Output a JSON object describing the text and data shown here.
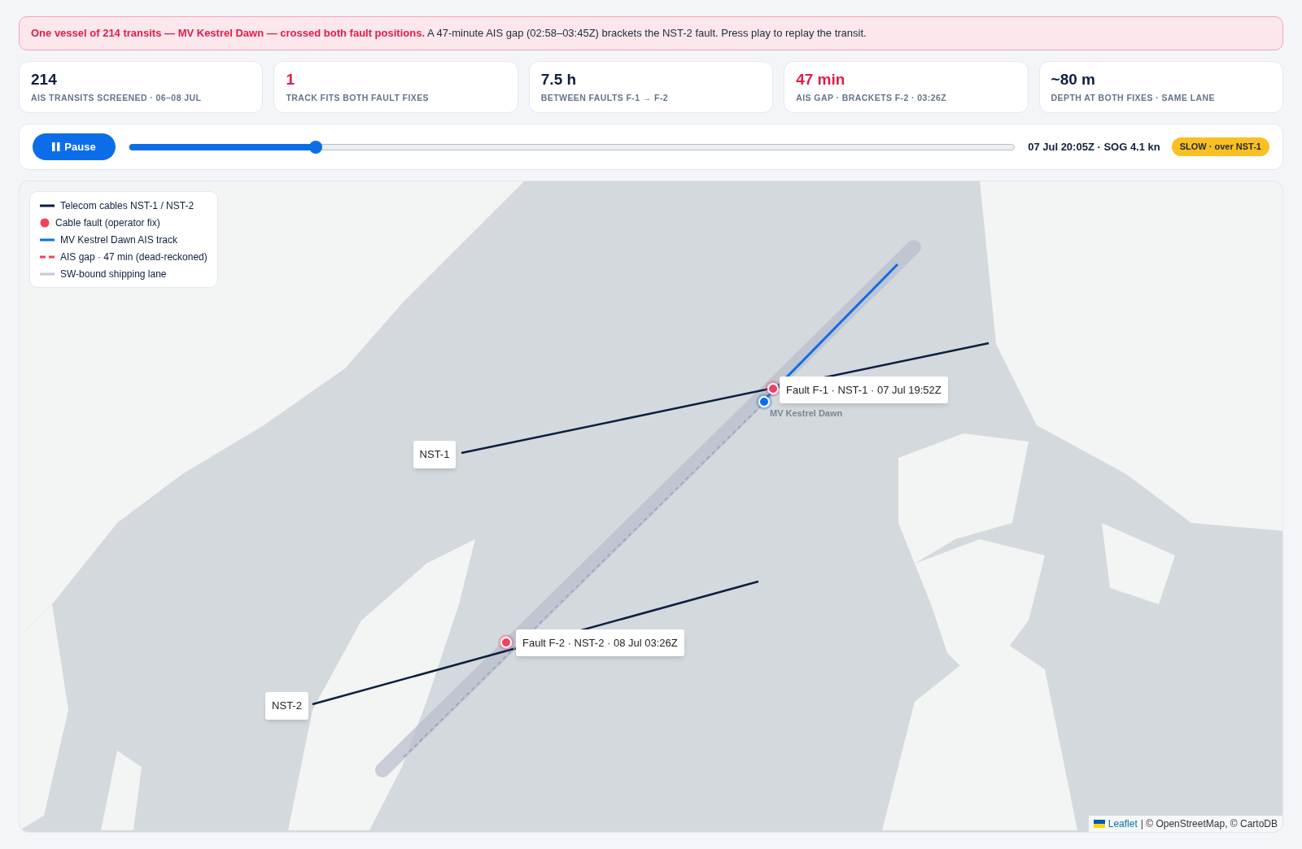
{
  "banner": {
    "text": "**One vessel of 214 transits — MV Kestrel Dawn — crossed both fault positions.** A 47-minute AIS gap (02:58–03:45Z) brackets the NST-2 fault. Press play to replay the transit."
  },
  "stats": [
    {
      "value": "214",
      "label": "AIS TRANSITS SCREENED · 06–08 JUL",
      "alert": false
    },
    {
      "value": "1",
      "label": "TRACK FITS BOTH FAULT FIXES",
      "alert": true
    },
    {
      "value": "7.5 h",
      "label": "BETWEEN FAULTS F-1 → F-2",
      "alert": false
    },
    {
      "value": "47 min",
      "label": "AIS GAP · BRACKETS F-2 · 03:26Z",
      "alert": true
    },
    {
      "value": "~80 m",
      "label": "DEPTH AT BOTH FIXES · SAME LANE",
      "alert": false
    }
  ],
  "playback": {
    "button": "Pause",
    "playing": true,
    "level": 0.211,
    "reading": "07 Jul 20:05Z · SOG 4.1 kn",
    "badge": "SLOW · over NST-1"
  },
  "map": {
    "legend": [
      {
        "kind": "cable",
        "label": "Telecom cables NST-1 / NST-2"
      },
      {
        "kind": "fault",
        "label": "Cable fault (operator fix)"
      },
      {
        "kind": "track",
        "label": "MV Kestrel Dawn AIS track"
      },
      {
        "kind": "gap",
        "label": "AIS gap · 47 min (dead-reckoned)"
      },
      {
        "kind": "lane",
        "label": "SW-bound shipping lane"
      }
    ],
    "cables": [
      {
        "label": "NST-1"
      },
      {
        "label": "NST-2"
      }
    ],
    "faults": [
      {
        "label": "Fault F-1 · NST-1 · 07 Jul 19:52Z"
      },
      {
        "label": "Fault F-2 · NST-2 · 08 Jul 03:26Z"
      }
    ],
    "vessel": {
      "label": "MV Kestrel Dawn"
    },
    "attribution": {
      "link": "Leaflet",
      "text": "| © OpenStreetMap, © CartoDB"
    }
  }
}
